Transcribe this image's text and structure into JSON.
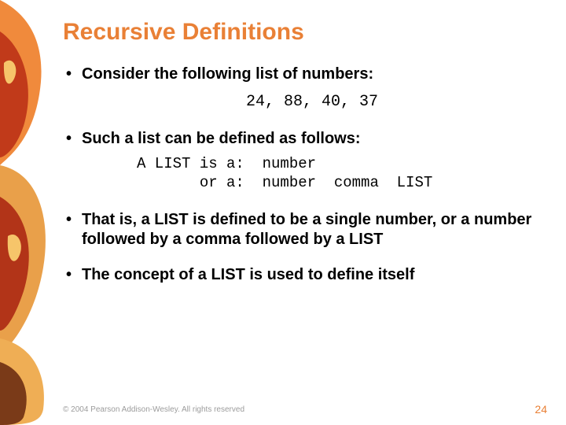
{
  "title": "Recursive Definitions",
  "bullets": {
    "b1": "Consider the following list of numbers:",
    "b2": "Such a list can be defined as follows:",
    "b3": "That is, a LIST is defined to be a single number, or a number followed by a comma followed by a LIST",
    "b4": "The concept of a LIST is used to define itself"
  },
  "code_numbers": "24, 88, 40, 37",
  "def_lines": "A LIST is a:  number\n       or a:  number  comma  LIST",
  "footer": "© 2004 Pearson Addison-Wesley. All rights reserved",
  "page_number": "24"
}
